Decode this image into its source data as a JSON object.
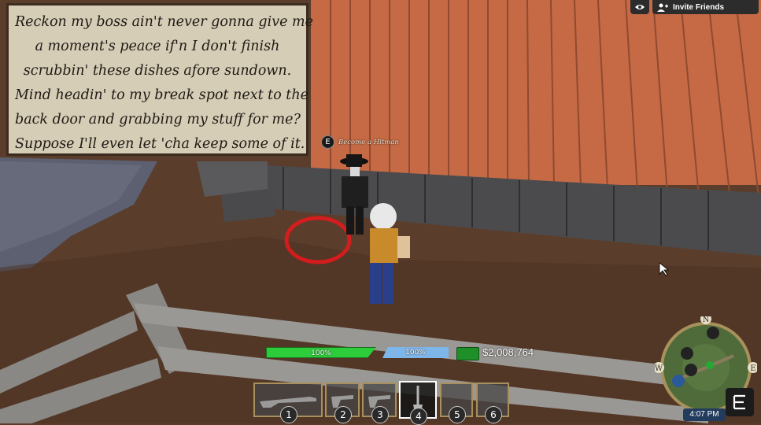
{
  "dialogue": {
    "lines": [
      "Reckon my boss ain't never gonna give me",
      "a moment's peace if'n I don't finish",
      "scrubbin' these dishes afore sundown.",
      "Mind headin' to my break spot next to the",
      "back door and grabbing my stuff for me?",
      "Suppose I'll even let 'cha keep some of it."
    ]
  },
  "prompt": {
    "key": "E",
    "label": "Become a Hitman"
  },
  "topbar": {
    "invite_label": "Invite Friends"
  },
  "hud": {
    "health": {
      "text": "100%",
      "fraction": 1.0,
      "color": "#2ccc3a"
    },
    "stamina": {
      "text": "100%",
      "fraction": 1.0,
      "color": "#7fb6ea"
    },
    "money": "$2,008,764"
  },
  "hotbar": [
    {
      "number": "1",
      "item": "rifle-icon",
      "selected": false
    },
    {
      "number": "2",
      "item": "revolver-icon",
      "selected": false
    },
    {
      "number": "3",
      "item": "revolver-icon",
      "selected": false
    },
    {
      "number": "4",
      "item": "shovel-icon",
      "selected": true
    },
    {
      "number": "5",
      "item": "",
      "selected": false
    },
    {
      "number": "6",
      "item": "",
      "selected": false
    }
  ],
  "minimap": {
    "compass": [
      "N",
      "E",
      "W"
    ],
    "clock": "4:07 PM"
  },
  "colors": {
    "wall": "#c56a45",
    "ground": "#5a3b2a",
    "dialogue_bg": "#d6cdb7",
    "ring": "#e0191d"
  }
}
